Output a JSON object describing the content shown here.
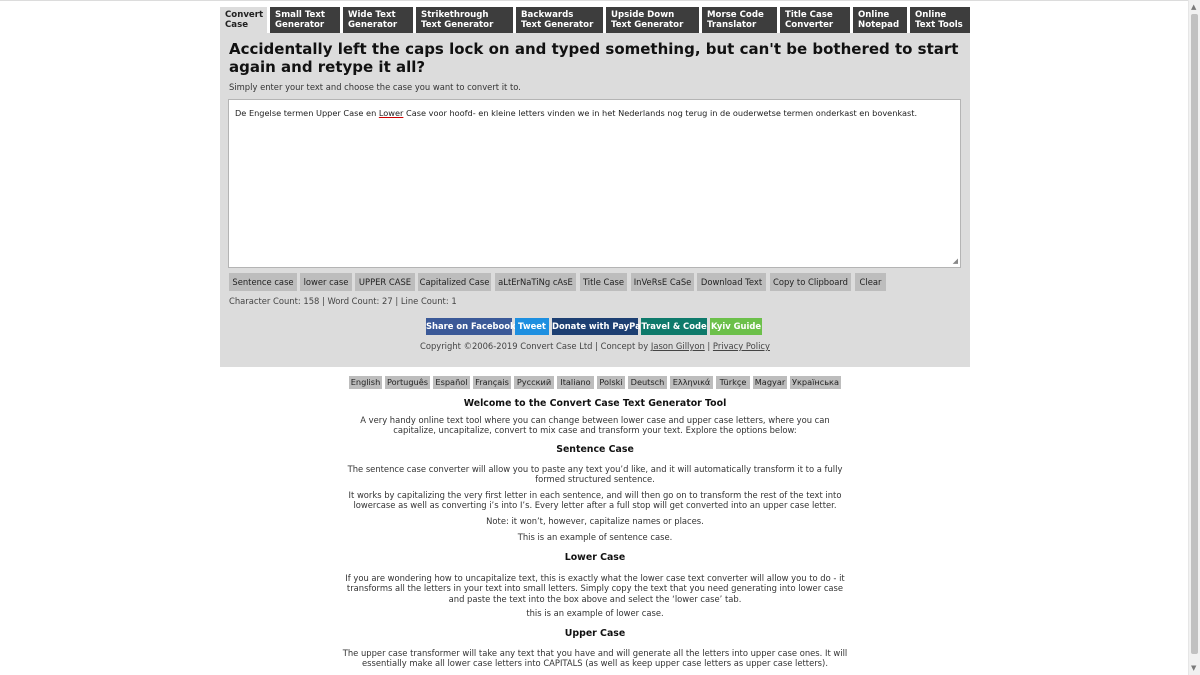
{
  "nav": {
    "tabs": [
      {
        "line1": "Convert",
        "line2": "Case",
        "active": true
      },
      {
        "line1": "Small Text",
        "line2": "Generator"
      },
      {
        "line1": "Wide Text",
        "line2": "Generator"
      },
      {
        "line1": "Strikethrough",
        "line2": "Text Generator"
      },
      {
        "line1": "Backwards",
        "line2": "Text Generator"
      },
      {
        "line1": "Upside Down",
        "line2": "Text Generator"
      },
      {
        "line1": "Morse Code",
        "line2": "Translator"
      },
      {
        "line1": "Title Case",
        "line2": "Converter"
      },
      {
        "line1": "Online",
        "line2": "Notepad"
      },
      {
        "line1": "Online",
        "line2": "Text Tools"
      }
    ]
  },
  "main": {
    "headline": "Accidentally left the caps lock on and typed something, but can't be bothered to start again and retype it all?",
    "subline": "Simply enter your text and choose the case you want to convert it to.",
    "textarea": {
      "before": "De Engelse termen Upper Case en ",
      "underlined": "Lower",
      "after": " Case voor hoofd- en kleine letters vinden we in het Nederlands nog terug in de ouderwetse termen onderkast en bovenkast."
    },
    "buttons": [
      "Sentence case",
      "lower case",
      "UPPER CASE",
      "Capitalized Case",
      "aLtErNaTiNg cAsE",
      "Title Case",
      "InVeRsE CaSe",
      "Download Text",
      "Copy to Clipboard",
      "Clear"
    ],
    "counts": "Character Count: 158 | Word Count: 27 | Line Count: 1",
    "share": [
      {
        "label": "Share on Facebook",
        "color": "#3b5998"
      },
      {
        "label": "Tweet",
        "color": "#1d8fe0"
      },
      {
        "label": "Donate with PayPal",
        "color": "#1d3f72"
      },
      {
        "label": "Travel & Code",
        "color": "#0e7a6b"
      },
      {
        "label": "Kyiv Guide",
        "color": "#6cc04a"
      }
    ],
    "copyright": {
      "prefix": "Copyright ©2006-2019 Convert Case Ltd | Concept by ",
      "author_link": "Jason Gillyon",
      "separator": " | ",
      "privacy_link": "Privacy Policy"
    }
  },
  "languages": [
    "English",
    "Português",
    "Español",
    "Français",
    "Русский",
    "Italiano",
    "Polski",
    "Deutsch",
    "Ελληνικά",
    "Türkçe",
    "Magyar",
    "Українська"
  ],
  "article": {
    "welcome_title": "Welcome to the Convert Case Text Generator Tool",
    "welcome_p": "A very handy online text tool where you can change between lower case and upper case letters, where you can capitalize, uncapitalize, convert to mix case and transform your text. Explore the options below:",
    "sentence_title": "Sentence Case",
    "sentence_p1": "The sentence case converter will allow you to paste any text you’d like, and it will automatically transform it to a fully formed structured sentence.",
    "sentence_p2": "It works by capitalizing the very first letter in each sentence, and will then go on to transform the rest of the text into lowercase as well as converting i’s into I’s. Every letter after a full stop will get converted into an upper case letter.",
    "sentence_p3": "Note: it won’t, however, capitalize names or places.",
    "sentence_p4": "This is an example of sentence case.",
    "lower_title": "Lower Case",
    "lower_p1": "If you are wondering how to uncapitalize text, this is exactly what the lower case text converter will allow you to do - it transforms all the letters in your text into small letters. Simply copy the text that you need generating into lower case and paste the text into the box above and select the ‘lower case’ tab.",
    "lower_p2": "this is an example of lower case.",
    "upper_title": "Upper Case",
    "upper_p1": "The upper case transformer will take any text that you have and will generate all the letters into upper case ones. It will essentially make all lower case letters into CAPITALS (as well as keep upper case letters as upper case letters)."
  }
}
